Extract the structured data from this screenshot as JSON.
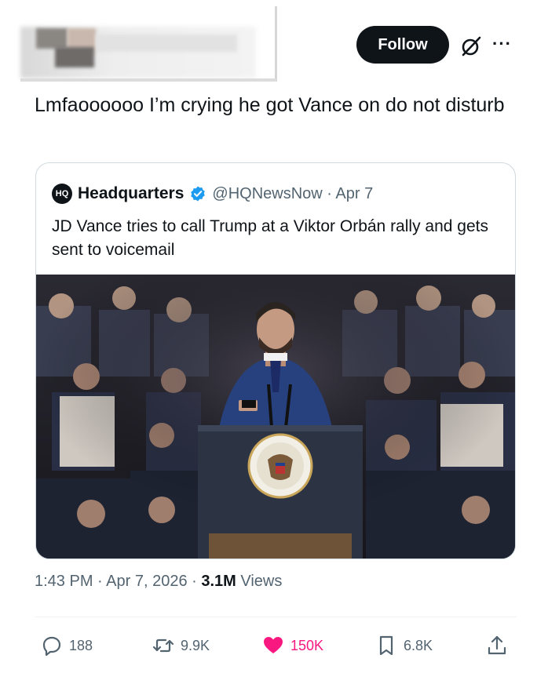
{
  "header": {
    "follow_label": "Follow",
    "grok_icon": "grok-icon",
    "more_icon": "more-icon",
    "more_glyph": "···"
  },
  "tweet": {
    "text": "Lmfaoooooo I’m crying he got Vance on do not disturb"
  },
  "quote": {
    "avatar_text": "HQ",
    "name": "Headquarters",
    "handle_date": "@HQNewsNow · Apr 7",
    "text": "JD Vance tries to call Trump at a Viktor Orbán rally and gets sent to voicemail"
  },
  "meta": {
    "time_date": "1:43 PM · Apr 7, 2026 · ",
    "views_count": "3.1M",
    "views_label": " Views"
  },
  "actions": {
    "replies": "188",
    "reposts": "9.9K",
    "likes": "150K",
    "bookmarks": "6.8K"
  },
  "colors": {
    "like": "#f91880",
    "muted": "#536471",
    "verified": "#1d9bf0"
  }
}
